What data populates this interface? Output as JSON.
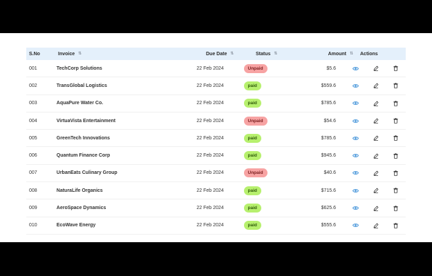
{
  "table": {
    "headers": {
      "sno": "S.No",
      "invoice": "Invoice",
      "due_date": "Due Date",
      "status": "Status",
      "amount": "Amount",
      "actions": "Actions"
    },
    "rows": [
      {
        "sno": "001",
        "invoice": "TechCorp Solutions",
        "due": "22 Feb 2024",
        "status": "Unpaid",
        "status_type": "unpaid",
        "amount": "$5.6"
      },
      {
        "sno": "002",
        "invoice": "TransGlobal Logistics",
        "due": "22 Feb 2024",
        "status": "paid",
        "status_type": "paid",
        "amount": "$559.6"
      },
      {
        "sno": "003",
        "invoice": "AquaPure Water Co.",
        "due": "22 Feb 2024",
        "status": "paid",
        "status_type": "paid",
        "amount": "$785.6"
      },
      {
        "sno": "004",
        "invoice": "VirtuaVista Entertainment",
        "due": "22 Feb 2024",
        "status": "Unpaid",
        "status_type": "unpaid",
        "amount": "$54.6"
      },
      {
        "sno": "005",
        "invoice": "GreenTech Innovations",
        "due": "22 Feb 2024",
        "status": "paid",
        "status_type": "paid",
        "amount": "$785.6"
      },
      {
        "sno": "006",
        "invoice": "Quantum Finance Corp",
        "due": "22 Feb 2024",
        "status": "paid",
        "status_type": "paid",
        "amount": "$945.6"
      },
      {
        "sno": "007",
        "invoice": "UrbanEats Culinary Group",
        "due": "22 Feb 2024",
        "status": "Unpaid",
        "status_type": "unpaid",
        "amount": "$40.6"
      },
      {
        "sno": "008",
        "invoice": "NaturaLife Organics",
        "due": "22 Feb 2024",
        "status": "paid",
        "status_type": "paid",
        "amount": "$715.6"
      },
      {
        "sno": "009",
        "invoice": "AeroSpace Dynamics",
        "due": "22 Feb 2024",
        "status": "paid",
        "status_type": "paid",
        "amount": "$625.6"
      },
      {
        "sno": "010",
        "invoice": "EcoWave Energy",
        "due": "22 Feb 2024",
        "status": "paid",
        "status_type": "paid",
        "amount": "$555.6"
      }
    ],
    "action_icons": [
      "eye-icon",
      "pencil-icon",
      "trash-icon"
    ]
  },
  "colors": {
    "header_bg": "#e4f0fb",
    "paid_badge": "#b7f06e",
    "unpaid_badge": "#f7a3a3",
    "view_icon": "#3b8fd8",
    "edit_icon": "#333333",
    "delete_icon": "#333333"
  }
}
